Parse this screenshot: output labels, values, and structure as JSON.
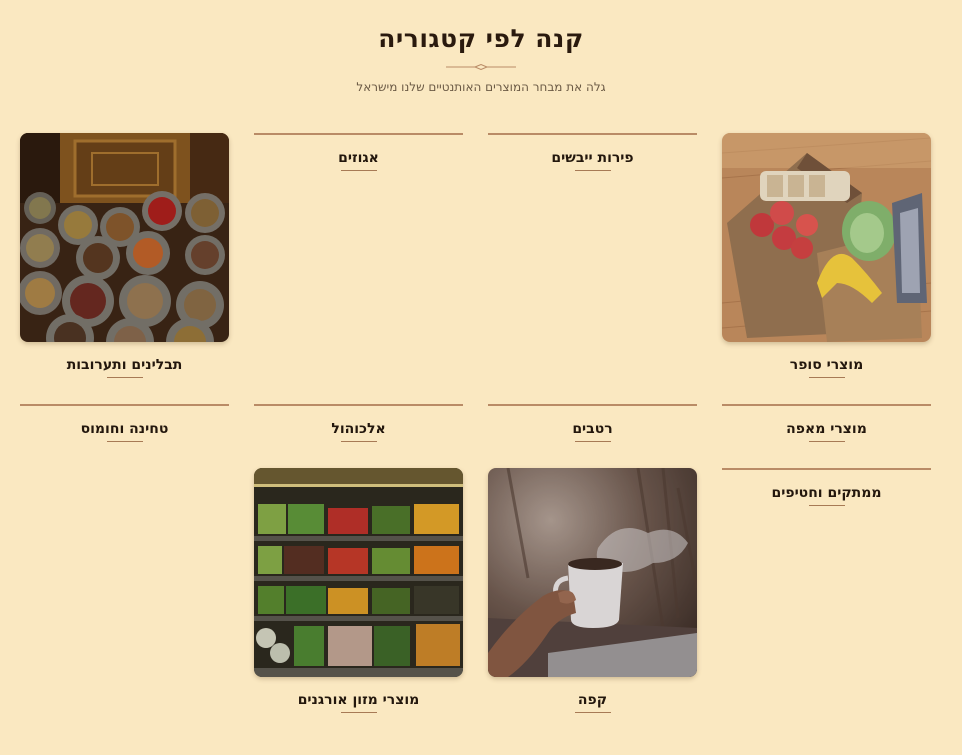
{
  "header": {
    "title": "קנה לפי קטגוריה",
    "subtitle": "גלה את מבחר המוצרים האותנטיים שלנו מישראל"
  },
  "categories": [
    {
      "label": "מוצרי סופר",
      "image": "grocery-bags-photo"
    },
    {
      "label": "פירות ייבשים",
      "image": null
    },
    {
      "label": "אגוזים",
      "image": null
    },
    {
      "label": "תבלינים ותערובות",
      "image": "spice-bowls-photo"
    },
    {
      "label": "מוצרי מאפה",
      "image": null
    },
    {
      "label": "רטבים",
      "image": null
    },
    {
      "label": "אלכוהול",
      "image": null
    },
    {
      "label": "טחינה וחומוס",
      "image": null
    },
    {
      "label": "ממתקים וחטיפים",
      "image": null
    },
    {
      "label": "קפה",
      "image": "coffee-cup-photo"
    },
    {
      "label": "מוצרי מזון אורגנים",
      "image": "organic-produce-photo"
    }
  ],
  "colors": {
    "background": "#fae8c1",
    "accent_line": "#b98b66",
    "title": "#2a1a0e"
  }
}
